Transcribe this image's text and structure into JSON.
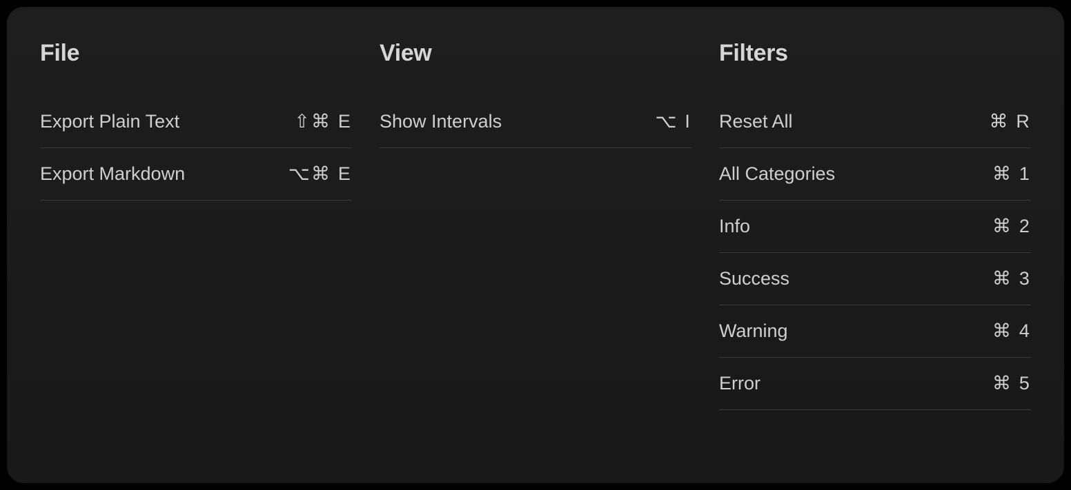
{
  "columns": [
    {
      "title": "File",
      "items": [
        {
          "label": "Export Plain Text",
          "shortcut": "⇧⌘ E",
          "name": "export-plain-text"
        },
        {
          "label": "Export Markdown",
          "shortcut": "⌥⌘ E",
          "name": "export-markdown"
        }
      ]
    },
    {
      "title": "View",
      "items": [
        {
          "label": "Show Intervals",
          "shortcut": "⌥ I",
          "name": "show-intervals"
        }
      ]
    },
    {
      "title": "Filters",
      "items": [
        {
          "label": "Reset All",
          "shortcut": "⌘ R",
          "name": "reset-all"
        },
        {
          "label": "All Categories",
          "shortcut": "⌘ 1",
          "name": "all-categories"
        },
        {
          "label": "Info",
          "shortcut": "⌘ 2",
          "name": "info"
        },
        {
          "label": "Success",
          "shortcut": "⌘ 3",
          "name": "success"
        },
        {
          "label": "Warning",
          "shortcut": "⌘ 4",
          "name": "warning"
        },
        {
          "label": "Error",
          "shortcut": "⌘ 5",
          "name": "error"
        }
      ]
    }
  ]
}
